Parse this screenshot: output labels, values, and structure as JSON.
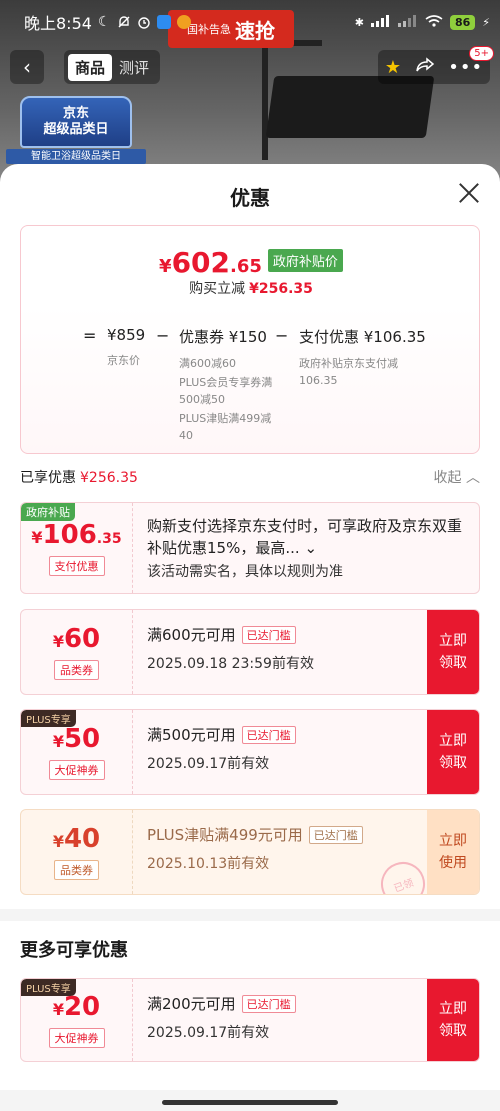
{
  "status_bar": {
    "time": "晚上8:54",
    "moon_icon": "moon-icon",
    "battery": "86"
  },
  "top_nav": {
    "tabs": [
      {
        "label": "商品"
      },
      {
        "label": "测评"
      }
    ],
    "badge": "5+"
  },
  "banner": {
    "small": "国补告急",
    "text": "速抢"
  },
  "promo": {
    "line1": "京东",
    "line2": "超级品类日",
    "strip": "智能卫浴超级品类日"
  },
  "sheet": {
    "title": "优惠"
  },
  "price_card": {
    "symbol": "¥",
    "integer": "602",
    "decimal": ".65",
    "tag": "政府补贴价",
    "buy_reduce_label": "购买立减",
    "buy_reduce_amount": "¥256.35",
    "breakdown": {
      "op_eq": "=",
      "op_minus1": "−",
      "op_minus2": "−",
      "jd_price": {
        "value": "¥859",
        "label": "京东价"
      },
      "coupon": {
        "value": "优惠券 ¥150",
        "lines": [
          "满600减60",
          "PLUS会员专享券满500减50",
          "PLUS津贴满499减40"
        ]
      },
      "payment": {
        "value": "支付优惠 ¥106.35",
        "lines": [
          "政府补贴京东支付减106.35"
        ]
      }
    }
  },
  "enjoyed": {
    "label": "已享优惠",
    "amount": "¥256.35",
    "collapse": "收起"
  },
  "gov_coupon": {
    "badge": "政府补贴",
    "symbol": "¥",
    "integer": "106",
    "decimal": ".35",
    "tag": "支付优惠",
    "desc": "购新支付选择京东支付时，可享政府及京东双重补贴优惠15%，最高...",
    "note": "该活动需实名，具体以规则为准"
  },
  "coupons": [
    {
      "symbol": "¥",
      "amount": "60",
      "tag": "品类券",
      "title": "满600元可用",
      "threshold": "已达门槛",
      "date": "2025.09.18 23:59前有效",
      "btn": "立即领取",
      "plus": ""
    },
    {
      "symbol": "¥",
      "amount": "50",
      "tag": "大促神券",
      "title": "满500元可用",
      "threshold": "已达门槛",
      "date": "2025.09.17前有效",
      "btn": "立即领取",
      "plus": "PLUS专享"
    },
    {
      "symbol": "¥",
      "amount": "40",
      "tag": "品类券",
      "title": "PLUS津贴满499元可用",
      "threshold": "已达门槛",
      "date": "2025.10.13前有效",
      "btn": "立即使用",
      "plus": "",
      "stamp": "已领"
    }
  ],
  "more": {
    "title": "更多可享优惠",
    "coupon": {
      "symbol": "¥",
      "amount": "20",
      "tag": "大促神券",
      "title": "满200元可用",
      "threshold": "已达门槛",
      "date": "2025.09.17前有效",
      "btn": "立即领取",
      "plus": "PLUS专享"
    }
  }
}
